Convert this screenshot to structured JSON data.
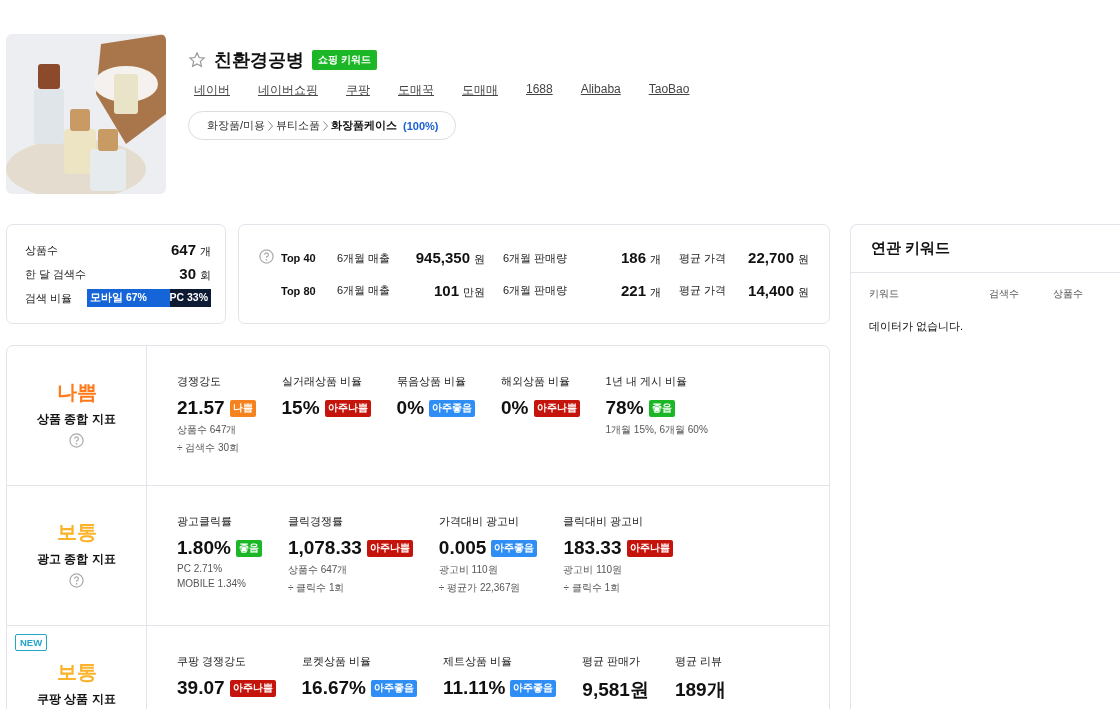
{
  "product": {
    "starred": false,
    "title": "친환경공병",
    "tag": "쇼핑 키워드",
    "links": [
      "네이버",
      "네이버쇼핑",
      "쿠팡",
      "도매꾹",
      "도매매",
      "1688",
      "Alibaba",
      "TaoBao"
    ],
    "category": [
      {
        "label": "화장품/미용",
        "current": false
      },
      {
        "label": "뷰티소품",
        "current": false
      },
      {
        "label": "화장품케이스",
        "current": true
      }
    ],
    "category_share": "(100%)"
  },
  "summary": {
    "rows": [
      {
        "label": "상품수",
        "value": "647",
        "unit": "개"
      },
      {
        "label": "한 달 검색수",
        "value": "30",
        "unit": "회"
      }
    ],
    "ratio": {
      "label": "검색 비율",
      "mobile": "모바일 67%",
      "pc": "PC 33%",
      "level": 0.67
    }
  },
  "tops": [
    {
      "label": "Top 40",
      "help": true,
      "cells": [
        {
          "label": "6개월 매출",
          "value": "945,350",
          "unit": "원"
        },
        {
          "label": "6개월 판매량",
          "value": "186",
          "unit": "개"
        },
        {
          "label": "평균 가격",
          "value": "22,700",
          "unit": "원"
        }
      ]
    },
    {
      "label": "Top 80",
      "help": false,
      "cells": [
        {
          "label": "6개월 매출",
          "value": "101",
          "unit": "만원"
        },
        {
          "label": "6개월 판매량",
          "value": "221",
          "unit": "개"
        },
        {
          "label": "평균 가격",
          "value": "14,400",
          "unit": "원"
        }
      ]
    }
  ],
  "indicators": [
    {
      "new": false,
      "color": "#ff7a1a",
      "grade_label": "나쁨",
      "title": "상품 종합 지표",
      "help": true,
      "metrics": [
        {
          "label": "경쟁강도",
          "value": "21.57",
          "badge": {
            "color": "#f5821f",
            "text": "나쁨"
          },
          "notes": [
            "상품수 647개",
            "÷ 검색수 30회"
          ]
        },
        {
          "label": "실거래상품 비율",
          "value": "15%",
          "badge": {
            "color": "#c4140c",
            "text": "아주나쁨"
          }
        },
        {
          "label": "묶음상품 비율",
          "value": "0%",
          "badge": {
            "color": "#2f8ef5",
            "text": "아주좋음"
          }
        },
        {
          "label": "해외상품 비율",
          "value": "0%",
          "badge": {
            "color": "#c4140c",
            "text": "아주나쁨"
          }
        },
        {
          "label": "1년 내 게시 비율",
          "value": "78%",
          "badge": {
            "color": "#1bb726",
            "text": "좋음"
          },
          "notes": [
            "1개월 15%, 6개월 60%"
          ]
        }
      ]
    },
    {
      "new": false,
      "color": "#fbb32b",
      "grade_label": "보통",
      "title": "광고 종합 지표",
      "help": true,
      "metrics": [
        {
          "label": "광고클릭률",
          "value": "1.80%",
          "badge": {
            "color": "#1bb726",
            "text": "좋음"
          },
          "notes": [
            "PC 2.71%",
            "MOBILE 1.34%"
          ]
        },
        {
          "label": "클릭경쟁률",
          "value": "1,078.33",
          "badge": {
            "color": "#c4140c",
            "text": "아주나쁨"
          },
          "notes": [
            "상품수 647개",
            "÷ 클릭수 1회"
          ]
        },
        {
          "label": "가격대비 광고비",
          "value": "0.005",
          "badge": {
            "color": "#2f8ef5",
            "text": "아주좋음"
          },
          "notes": [
            "광고비 110원",
            "÷ 평균가 22,367원"
          ]
        },
        {
          "label": "클릭대비 광고비",
          "value": "183.33",
          "badge": {
            "color": "#c4140c",
            "text": "아주나쁨"
          },
          "notes": [
            "광고비 110원",
            "÷ 클릭수 1회"
          ]
        }
      ]
    },
    {
      "new": true,
      "new_label": "NEW",
      "color": "#fbb32b",
      "grade_label": "보통",
      "title": "쿠팡 상품 지표",
      "help": false,
      "metrics": [
        {
          "label": "쿠팡 경쟁강도",
          "value": "39.07",
          "badge": {
            "color": "#c4140c",
            "text": "아주나쁨"
          }
        },
        {
          "label": "로켓상품 비율",
          "value": "16.67%",
          "badge": {
            "color": "#2f8ef5",
            "text": "아주좋음"
          }
        },
        {
          "label": "제트상품 비율",
          "value": "11.11%",
          "badge": {
            "color": "#2f8ef5",
            "text": "아주좋음"
          }
        },
        {
          "label": "평균 판매가",
          "value": "9,581원"
        },
        {
          "label": "평균 리뷰",
          "value": "189개"
        }
      ]
    }
  ],
  "related": {
    "title": "연관 키워드",
    "columns": [
      "키워드",
      "검색수",
      "상품수"
    ],
    "empty": "데이터가 없습니다."
  }
}
